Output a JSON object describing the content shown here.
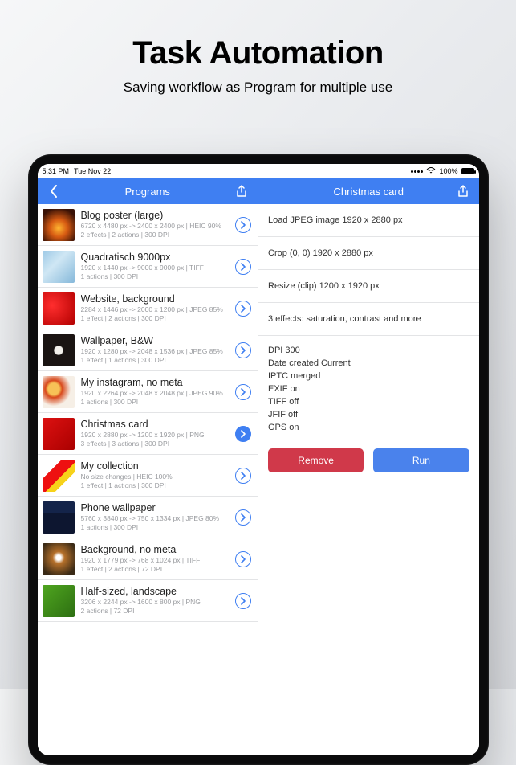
{
  "hero": {
    "title": "Task Automation",
    "subtitle": "Saving workflow as Program for multiple use"
  },
  "status": {
    "time": "5:31 PM",
    "date": "Tue Nov 22",
    "battery_pct": "100%"
  },
  "left": {
    "header_title": "Programs",
    "items": [
      {
        "title": "Blog poster (large)",
        "meta1": "6720 x 4480 px -> 2400 x 2400 px | HEIC 90%",
        "meta2": "2 effects | 2 actions | 300 DPI",
        "selected": false
      },
      {
        "title": "Quadratisch 9000px",
        "meta1": "1920 x 1440 px -> 9000 x 9000 px | TIFF",
        "meta2": "1 actions | 300 DPI",
        "selected": false
      },
      {
        "title": "Website, background",
        "meta1": "2284 x 1446 px -> 2000 x 1200 px | JPEG 85%",
        "meta2": "1 effect | 2 actions | 300 DPI",
        "selected": false
      },
      {
        "title": "Wallpaper, B&W",
        "meta1": "1920 x 1280 px -> 2048 x 1536 px | JPEG 85%",
        "meta2": "1 effect | 1 actions | 300 DPI",
        "selected": false
      },
      {
        "title": "My instagram, no meta",
        "meta1": "1920 x 2264 px -> 2048 x 2048 px | JPEG 90%",
        "meta2": "1 actions | 300 DPI",
        "selected": false
      },
      {
        "title": "Christmas card",
        "meta1": "1920 x 2880 px -> 1200 x 1920 px | PNG",
        "meta2": "3 effects | 3 actions | 300 DPI",
        "selected": true
      },
      {
        "title": "My collection",
        "meta1": "No size changes | HEIC 100%",
        "meta2": "1 effect | 1 actions | 300 DPI",
        "selected": false
      },
      {
        "title": "Phone wallpaper",
        "meta1": "5760 x 3840 px -> 750 x 1334 px | JPEG 80%",
        "meta2": "1 actions | 300 DPI",
        "selected": false
      },
      {
        "title": "Background, no meta",
        "meta1": "1920 x 1779 px -> 768 x 1024 px | TIFF",
        "meta2": "1 effect | 2 actions | 72 DPI",
        "selected": false
      },
      {
        "title": "Half-sized, landscape",
        "meta1": "3206 x 2244 px -> 1600 x 800 px | PNG",
        "meta2": "2 actions | 72 DPI",
        "selected": false
      }
    ]
  },
  "right": {
    "header_title": "Christmas card",
    "lines": [
      "Load JPEG image 1920 x 2880 px",
      "Crop (0, 0) 1920 x 2880 px",
      "Resize (clip) 1200 x 1920 px",
      "3 effects: saturation, contrast and more"
    ],
    "block": [
      "DPI 300",
      "Date created Current",
      "IPTC merged",
      "EXIF on",
      "TIFF off",
      "JFIF off",
      "GPS on"
    ],
    "remove_label": "Remove",
    "run_label": "Run"
  }
}
